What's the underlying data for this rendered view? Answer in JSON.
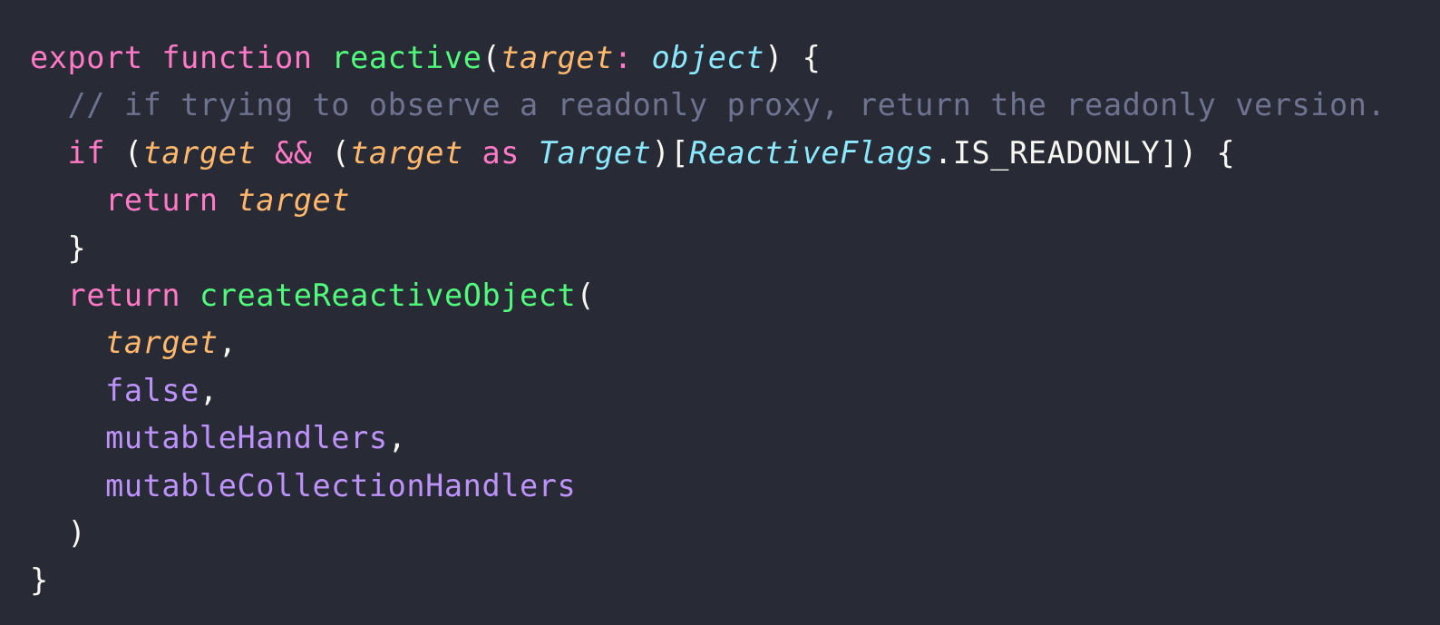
{
  "colors": {
    "background": "#282a36",
    "keyword": "#ff79c6",
    "function": "#50fa7b",
    "parameter": "#ffb86c",
    "type": "#8be9fd",
    "comment": "#6f7390",
    "constant": "#bd93f9",
    "plain": "#f8f8f2"
  },
  "lines": [
    [
      {
        "t": "export",
        "c": "kw"
      },
      {
        "t": " ",
        "c": "pl"
      },
      {
        "t": "function",
        "c": "kw"
      },
      {
        "t": " ",
        "c": "pl"
      },
      {
        "t": "reactive",
        "c": "fn"
      },
      {
        "t": "(",
        "c": "pl"
      },
      {
        "t": "target",
        "c": "param"
      },
      {
        "t": ": ",
        "c": "kw"
      },
      {
        "t": "object",
        "c": "type"
      },
      {
        "t": ") {",
        "c": "pl"
      }
    ],
    [
      {
        "t": "  // if trying to observe a readonly proxy, return the readonly version.",
        "c": "cm"
      }
    ],
    [
      {
        "t": "  ",
        "c": "pl"
      },
      {
        "t": "if",
        "c": "kw"
      },
      {
        "t": " (",
        "c": "pl"
      },
      {
        "t": "target",
        "c": "param"
      },
      {
        "t": " && ",
        "c": "kw"
      },
      {
        "t": "(",
        "c": "pl"
      },
      {
        "t": "target",
        "c": "param"
      },
      {
        "t": " as ",
        "c": "kw"
      },
      {
        "t": "Target",
        "c": "type"
      },
      {
        "t": ")[",
        "c": "pl"
      },
      {
        "t": "ReactiveFlags",
        "c": "type"
      },
      {
        "t": ".IS_READONLY]) {",
        "c": "pl"
      }
    ],
    [
      {
        "t": "    ",
        "c": "pl"
      },
      {
        "t": "return",
        "c": "kw"
      },
      {
        "t": " ",
        "c": "pl"
      },
      {
        "t": "target",
        "c": "param"
      }
    ],
    [
      {
        "t": "  }",
        "c": "pl"
      }
    ],
    [
      {
        "t": "  ",
        "c": "pl"
      },
      {
        "t": "return",
        "c": "kw"
      },
      {
        "t": " ",
        "c": "pl"
      },
      {
        "t": "createReactiveObject",
        "c": "fn"
      },
      {
        "t": "(",
        "c": "pl"
      }
    ],
    [
      {
        "t": "    ",
        "c": "pl"
      },
      {
        "t": "target",
        "c": "param"
      },
      {
        "t": ",",
        "c": "pl"
      }
    ],
    [
      {
        "t": "    ",
        "c": "pl"
      },
      {
        "t": "false",
        "c": "const"
      },
      {
        "t": ",",
        "c": "pl"
      }
    ],
    [
      {
        "t": "    ",
        "c": "pl"
      },
      {
        "t": "mutableHandlers",
        "c": "const"
      },
      {
        "t": ",",
        "c": "pl"
      }
    ],
    [
      {
        "t": "    ",
        "c": "pl"
      },
      {
        "t": "mutableCollectionHandlers",
        "c": "const"
      }
    ],
    [
      {
        "t": "  )",
        "c": "pl"
      }
    ],
    [
      {
        "t": "}",
        "c": "pl"
      }
    ]
  ]
}
